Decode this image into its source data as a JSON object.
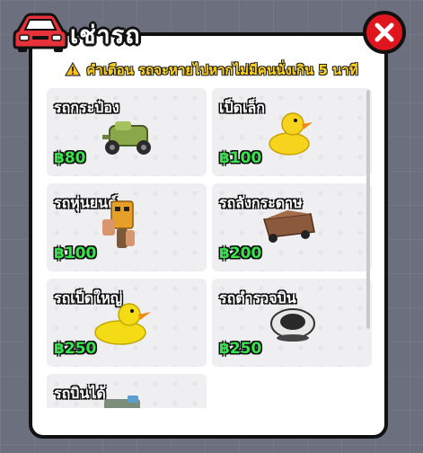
{
  "header": {
    "title": "เช่ารถ",
    "icon": "car-icon",
    "close_icon": "close-icon"
  },
  "warning": {
    "icon": "warning-icon",
    "text": "คำเตือน รถจะหายไปหากไม่มีคนนั่งเกิน 5 นาที"
  },
  "vehicles": [
    {
      "name": "รถกระป๋อง",
      "price": "฿80",
      "icon": "green-can-car-icon"
    },
    {
      "name": "เป็ดเล็ก",
      "price": "฿100",
      "icon": "small-duck-icon"
    },
    {
      "name": "รถหุ่นยนต์",
      "price": "฿100",
      "icon": "robot-car-icon"
    },
    {
      "name": "รถลังกระดาษ",
      "price": "฿200",
      "icon": "cardboard-box-car-icon"
    },
    {
      "name": "รถเป็ดใหญ่",
      "price": "฿250",
      "icon": "big-duck-icon"
    },
    {
      "name": "รถตำรวจบิน",
      "price": "฿250",
      "icon": "flying-police-car-icon"
    },
    {
      "name": "รถบินได้",
      "price": "",
      "icon": "flying-car-icon"
    }
  ],
  "colors": {
    "title_car": "#e8323a",
    "close": "#e0161e",
    "warning_text": "#ffd21f",
    "price_text": "#34e64a"
  }
}
